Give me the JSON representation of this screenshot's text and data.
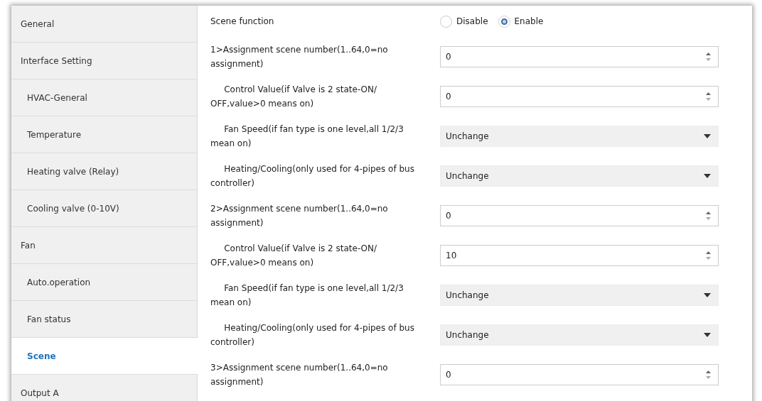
{
  "sidebar": {
    "items": [
      {
        "label": "General",
        "selected": false
      },
      {
        "label": "Interface Setting",
        "selected": false,
        "children": [
          {
            "label": "HVAC-General",
            "selected": false
          },
          {
            "label": "Temperature",
            "selected": false
          },
          {
            "label": "Heating valve (Relay)",
            "selected": false
          },
          {
            "label": "Cooling valve (0-10V)",
            "selected": false
          }
        ]
      },
      {
        "label": "Fan",
        "selected": false,
        "children": [
          {
            "label": "Auto.operation",
            "selected": false
          },
          {
            "label": "Fan status",
            "selected": false
          },
          {
            "label": "Scene",
            "selected": true
          }
        ]
      },
      {
        "label": "Output A",
        "selected": false
      }
    ]
  },
  "scene_function": {
    "label": "Scene function",
    "options": [
      {
        "label": "Disable",
        "selected": false
      },
      {
        "label": "Enable",
        "selected": true
      }
    ]
  },
  "scenes": [
    {
      "label": "1>Assignment scene number(1..64,0=no assignment)",
      "kind": "number",
      "value": "0",
      "children": [
        {
          "label": "Control Value(if Valve is 2 state-ON/ OFF,value>0 means on)",
          "kind": "number",
          "value": "0"
        },
        {
          "label": "Fan Speed(if fan type is one level,all 1/2/3 mean on)",
          "kind": "dropdown",
          "value": "Unchange"
        },
        {
          "label": "Heating/Cooling(only used for 4-pipes of bus controller)",
          "kind": "dropdown",
          "value": "Unchange"
        }
      ]
    },
    {
      "label": "2>Assignment scene number(1..64,0=no assignment)",
      "kind": "number",
      "value": "0",
      "children": [
        {
          "label": "Control Value(if Valve is 2 state-ON/ OFF,value>0 means on)",
          "kind": "number",
          "value": "10"
        },
        {
          "label": "Fan Speed(if fan type is one level,all 1/2/3 mean on)",
          "kind": "dropdown",
          "value": "Unchange"
        },
        {
          "label": "Heating/Cooling(only used for 4-pipes of bus controller)",
          "kind": "dropdown",
          "value": "Unchange"
        }
      ]
    },
    {
      "label": "3>Assignment scene number(1..64,0=no assignment)",
      "kind": "number",
      "value": "0"
    }
  ]
}
